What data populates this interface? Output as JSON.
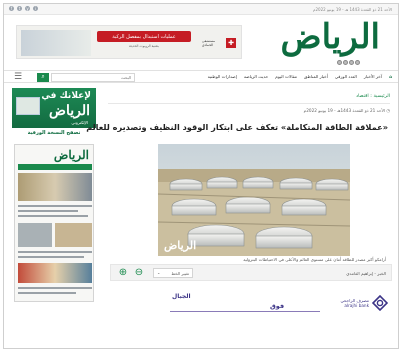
{
  "topbar": {
    "date_text": "الأحد 21 ذو القعدة 1443 هـ - 19 يونيو 2022م"
  },
  "header": {
    "masthead": "الرياض",
    "ad_title": "عمليات استبدال بمفصل الركبة",
    "ad_subtitle": "بتقنية الروبوت الحديثة",
    "ad_brand": "مستشفى الحمادي",
    "ad_brand_en": "AL HAMMADI HOSPITAL"
  },
  "nav": {
    "home_icon": "home-icon",
    "items": [
      "آخر الأخبار",
      "العدد الورقي",
      "أخبار المناطق",
      "مقالات اليوم",
      "حديث الرياضة",
      "إصدارات الوطنية"
    ],
    "search_placeholder": "البحث",
    "menu_icon": "hamburger-icon"
  },
  "sidebar": {
    "ad_line1": "لإعلانك في",
    "ad_line2": "الرياض",
    "ad_line3": "الإلكتروني",
    "section_title": "تصفح النسخة الورقية",
    "paper_head": "الرياض"
  },
  "article": {
    "breadcrumb_home": "الرئيسية",
    "breadcrumb_section": "اقتصاد",
    "date": "الأحد 21 ذو القعدة 1443هـ - 19 يونيو 2022م",
    "headline": "«عملاقة الطاقة المتكاملة» تعكف على ابتكار الوقود النظيف وتصديره للعالم",
    "photo_watermark": "الرياض",
    "caption": "أرامكو أكبر مصدر للطاقة أمان على مستوى العالم والأعلى في الاحتياطات البترولية",
    "byline": "الخبر - إبراهيم الغامدي",
    "font_select": "تغيير الخط"
  },
  "sponsor": {
    "text_top": "الجبال",
    "text_bottom": "فوق",
    "bank_name_ar": "مصرف الراجحي",
    "bank_name_en": "alrajhi bank"
  },
  "colors": {
    "brand_green": "#0d6b3f",
    "accent_green": "#1a8a4d",
    "sponsor_purple": "#3c3487"
  }
}
